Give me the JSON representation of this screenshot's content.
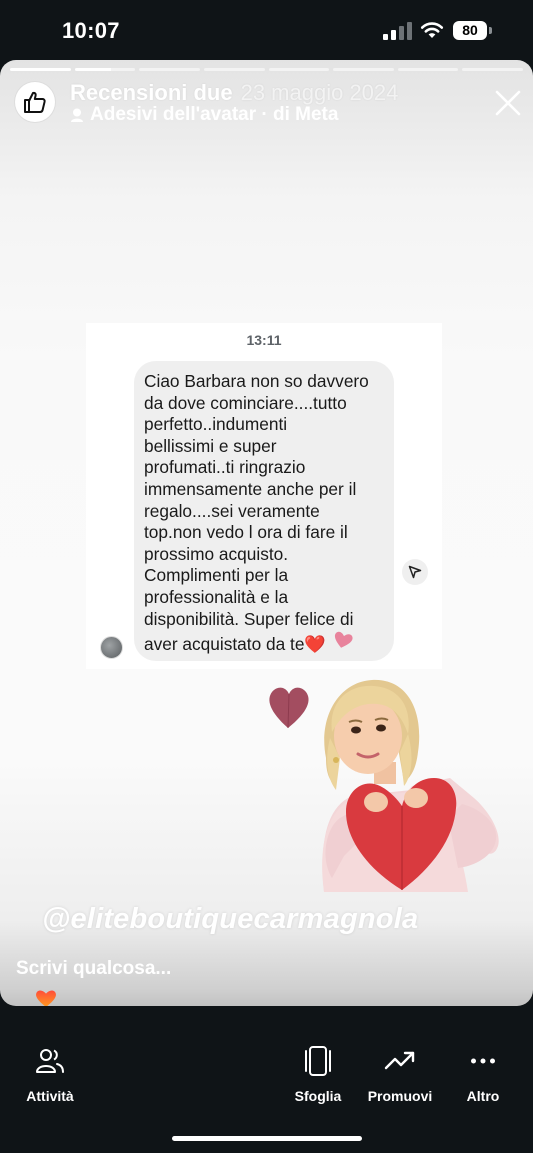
{
  "status_bar": {
    "time": "10:07",
    "battery": "80",
    "icons": [
      "signal-icon",
      "wifi-icon",
      "battery-icon"
    ]
  },
  "story": {
    "title": "Recensioni due",
    "date": "23 maggio 2024",
    "subtitle": "Adesivi dell'avatar · di Meta",
    "segments_total": 8,
    "segment_active_index": 1,
    "icons": [
      "thumbs-up-icon",
      "avatar-sticker-icon",
      "close-icon"
    ]
  },
  "chat": {
    "time": "13:11",
    "message": "Ciao Barbara non so davvero\nda dove cominciare....tutto\nperfetto..indumenti\nbellissimi e super\nprofumati..ti ringrazio\nimmensamente anche per il\nregalo....sei veramente\ntop.non vedo l ora di fare il\nprossimo acquisto.\nComplimenti per la\nprofessionalità e la\ndisponibilità. Super felice di\naver acquistato da te❤️",
    "icons": [
      "heart-emoji-icon",
      "share-icon"
    ]
  },
  "mention": "@eliteboutiquecarmagnola",
  "reply": {
    "placeholder": "Scrivi qualcosa..."
  },
  "nav": {
    "items": [
      {
        "label": "Attività",
        "icon": "people-icon"
      },
      {
        "label": "Sfoglia",
        "icon": "carousel-icon"
      },
      {
        "label": "Promuovi",
        "icon": "trend-up-icon"
      },
      {
        "label": "Altro",
        "icon": "more-icon"
      }
    ]
  },
  "colors": {
    "background": "#0f1417",
    "heart": "#e0233b",
    "pink_heart": "#e8839c"
  }
}
